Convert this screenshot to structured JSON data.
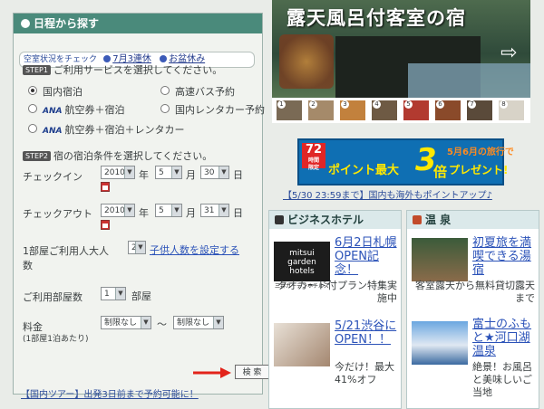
{
  "left": {
    "header": "日程から探す",
    "vacancy": {
      "check": "空室状況をチェック",
      "link1": "7月3連休",
      "link2": "お盆休み"
    },
    "step1": {
      "tag": "STEP1",
      "text": "ご利用サービスを選択してください。"
    },
    "services": [
      {
        "label": "国内宿泊",
        "prefix": ""
      },
      {
        "label": "高速バス予約",
        "prefix": ""
      },
      {
        "label": "航空券＋宿泊",
        "prefix": "ANA"
      },
      {
        "label": "国内レンタカー予約",
        "prefix": ""
      },
      {
        "label": "航空券＋宿泊＋レンタカー",
        "prefix": "ANA"
      }
    ],
    "step2": {
      "tag": "STEP2",
      "text": "宿の宿泊条件を選択してください。"
    },
    "checkin": {
      "label": "チェックイン",
      "year": "2010",
      "month": "5",
      "day": "30"
    },
    "checkout": {
      "label": "チェックアウト",
      "year": "2010",
      "month": "5",
      "day": "31"
    },
    "units": {
      "year": "年",
      "month": "月",
      "day": "日"
    },
    "guests": {
      "label_a": "1部屋ご利用人大人",
      "count": "2",
      "link": "子供人数を設定する",
      "label_b": "数"
    },
    "rooms": {
      "label": "ご利用部屋数",
      "count": "1",
      "unit": "部屋"
    },
    "price": {
      "label": "料金",
      "sub": "(1部屋1泊あたり)",
      "min": "制限なし",
      "sep": "〜",
      "max": "制限なし"
    },
    "search": "検 索",
    "tour_link": "【国内ツアー】出発3日前まで予約可能に！"
  },
  "hero": {
    "title": "露天風呂付客室の宿",
    "thumb_numbers": [
      "1",
      "2",
      "3",
      "4",
      "5",
      "6",
      "7",
      "8"
    ]
  },
  "promo": {
    "badge_num": "72",
    "badge_l1": "時間",
    "badge_l2": "限定",
    "point": "ポイント最大",
    "num": "3",
    "bai": "倍",
    "may": "5月6月の旅行で",
    "present": "プレゼント!",
    "link": "【5/30 23:59まで】国内も海外もポイントアップ♪"
  },
  "business": {
    "header": "ビジネスホテル",
    "logo_l1": "mitsui garden",
    "logo_l2": "hotels",
    "logo_l3": "三井ガーデンホテルズ",
    "title1": "6月2日札幌OPEN記念！",
    "desc1": "クオカード付プラン特集実施中",
    "title2": "5/21渋谷にOPEN！！",
    "desc2": "今だけ！最大41%オフ"
  },
  "onsen": {
    "header": "温 泉",
    "title1": "初夏旅を満喫できる湯宿",
    "desc1": "客室露天から無料貸切露天まで",
    "title2": "富士のふもと★河口湖温泉",
    "desc2": "絶景！お風呂と美味しいご当地"
  }
}
